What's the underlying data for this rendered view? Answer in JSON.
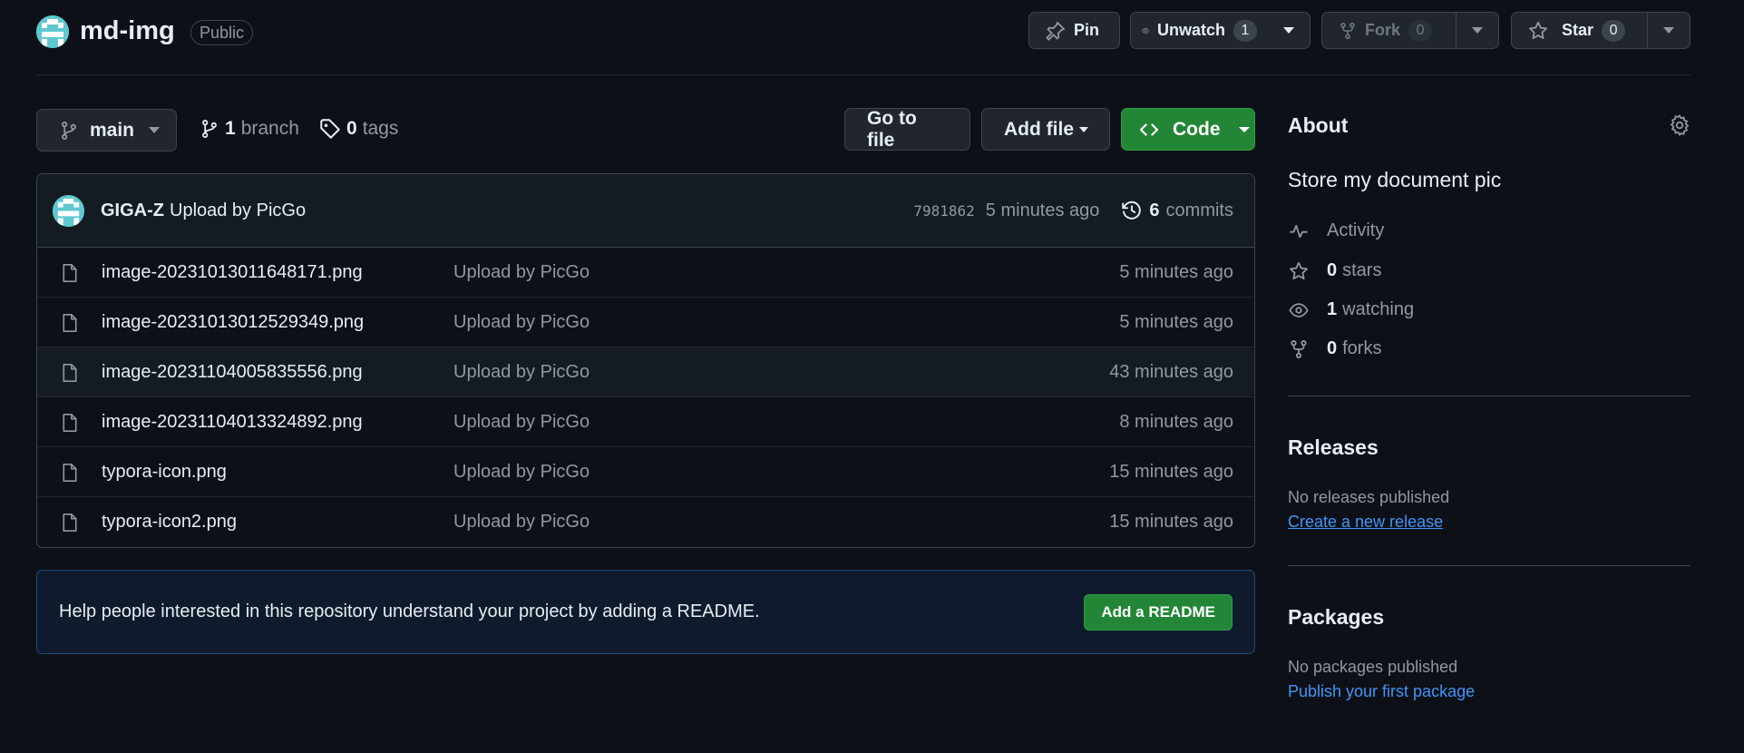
{
  "repo": {
    "name": "md-img",
    "visibility": "Public"
  },
  "header_actions": {
    "pin": "Pin",
    "watch": {
      "label": "Unwatch",
      "count": "1"
    },
    "fork": {
      "label": "Fork",
      "count": "0"
    },
    "star": {
      "label": "Star",
      "count": "0"
    }
  },
  "toolbar": {
    "branch": "main",
    "branches": {
      "count": "1",
      "label": "branch"
    },
    "tags": {
      "count": "0",
      "label": "tags"
    },
    "go_to_file": "Go to file",
    "add_file": "Add file",
    "code": "Code"
  },
  "latest_commit": {
    "author": "GIGA-Z",
    "message": "Upload by PicGo",
    "sha": "7981862",
    "time": "5 minutes ago",
    "commits_count": "6",
    "commits_label": "commits"
  },
  "files": [
    {
      "name": "image-20231013011648171.png",
      "message": "Upload by PicGo",
      "time": "5 minutes ago"
    },
    {
      "name": "image-20231013012529349.png",
      "message": "Upload by PicGo",
      "time": "5 minutes ago"
    },
    {
      "name": "image-20231104005835556.png",
      "message": "Upload by PicGo",
      "time": "43 minutes ago"
    },
    {
      "name": "image-20231104013324892.png",
      "message": "Upload by PicGo",
      "time": "8 minutes ago"
    },
    {
      "name": "typora-icon.png",
      "message": "Upload by PicGo",
      "time": "15 minutes ago"
    },
    {
      "name": "typora-icon2.png",
      "message": "Upload by PicGo",
      "time": "15 minutes ago"
    }
  ],
  "readme_banner": {
    "text": "Help people interested in this repository understand your project by adding a README.",
    "button": "Add a README"
  },
  "about": {
    "title": "About",
    "description": "Store my document pic",
    "activity": "Activity",
    "stars": {
      "count": "0",
      "label": "stars"
    },
    "watching": {
      "count": "1",
      "label": "watching"
    },
    "forks": {
      "count": "0",
      "label": "forks"
    }
  },
  "releases": {
    "title": "Releases",
    "empty": "No releases published",
    "link": "Create a new release"
  },
  "packages": {
    "title": "Packages",
    "empty": "No packages published",
    "link": "Publish your first package"
  },
  "colors": {
    "background": "#0d1117",
    "accent_green": "#238636",
    "link_blue": "#4493f8",
    "muted": "#9198a1"
  }
}
